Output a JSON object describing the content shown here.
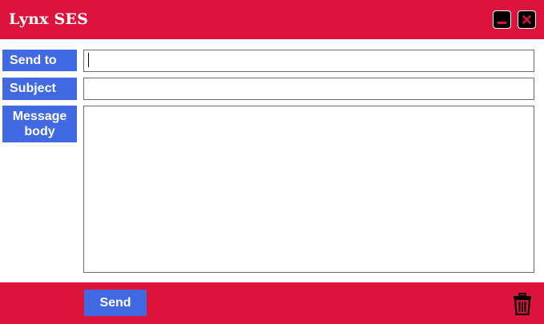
{
  "app": {
    "title": "Lynx SES"
  },
  "window_controls": {
    "minimize_icon": "minimize-icon",
    "close_icon": "close-icon"
  },
  "form": {
    "send_to_label": "Send to",
    "send_to_value": "",
    "subject_label": "Subject",
    "subject_value": "",
    "body_label": "Message\nbody",
    "body_value": ""
  },
  "footer": {
    "send_label": "Send",
    "delete_icon": "trash-icon"
  },
  "colors": {
    "titlebar": "#dc143c",
    "footer": "#dc143c",
    "label_bg": "#4169e1",
    "send_button_bg": "#4169e1",
    "text_on_accent": "#ffffff"
  }
}
